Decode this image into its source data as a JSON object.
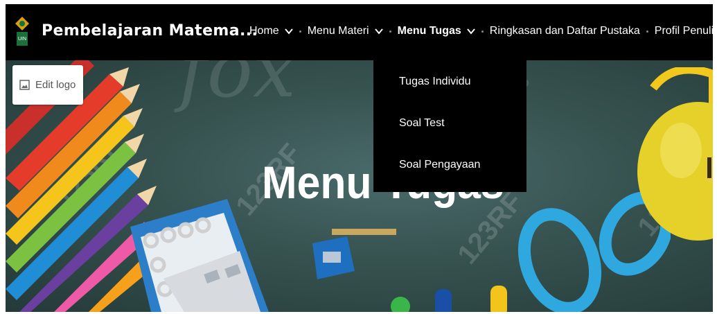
{
  "header": {
    "site_title": "Pembelajaran Matema...",
    "nav": [
      {
        "label": "Home",
        "has_dropdown": true,
        "active": false
      },
      {
        "label": "Menu Materi",
        "has_dropdown": true,
        "active": false
      },
      {
        "label": "Menu Tugas",
        "has_dropdown": true,
        "active": true
      },
      {
        "label": "Ringkasan dan Daftar Pustaka",
        "has_dropdown": false,
        "active": false
      },
      {
        "label": "Profil Penulis",
        "has_dropdown": false,
        "active": false
      }
    ]
  },
  "edit_logo": {
    "label": "Edit logo",
    "icon": "image-icon"
  },
  "dropdown": {
    "items": [
      {
        "label": "Tugas Individu"
      },
      {
        "label": "Soal Test"
      },
      {
        "label": "Soal Pengayaan"
      }
    ]
  },
  "hero": {
    "title": "Menu Tugas",
    "chalk_text": "fox",
    "watermark": "123RF"
  },
  "colors": {
    "navbar": "#000000",
    "accent_underline": "#c8a75f",
    "hero_bg": "#36524f"
  }
}
